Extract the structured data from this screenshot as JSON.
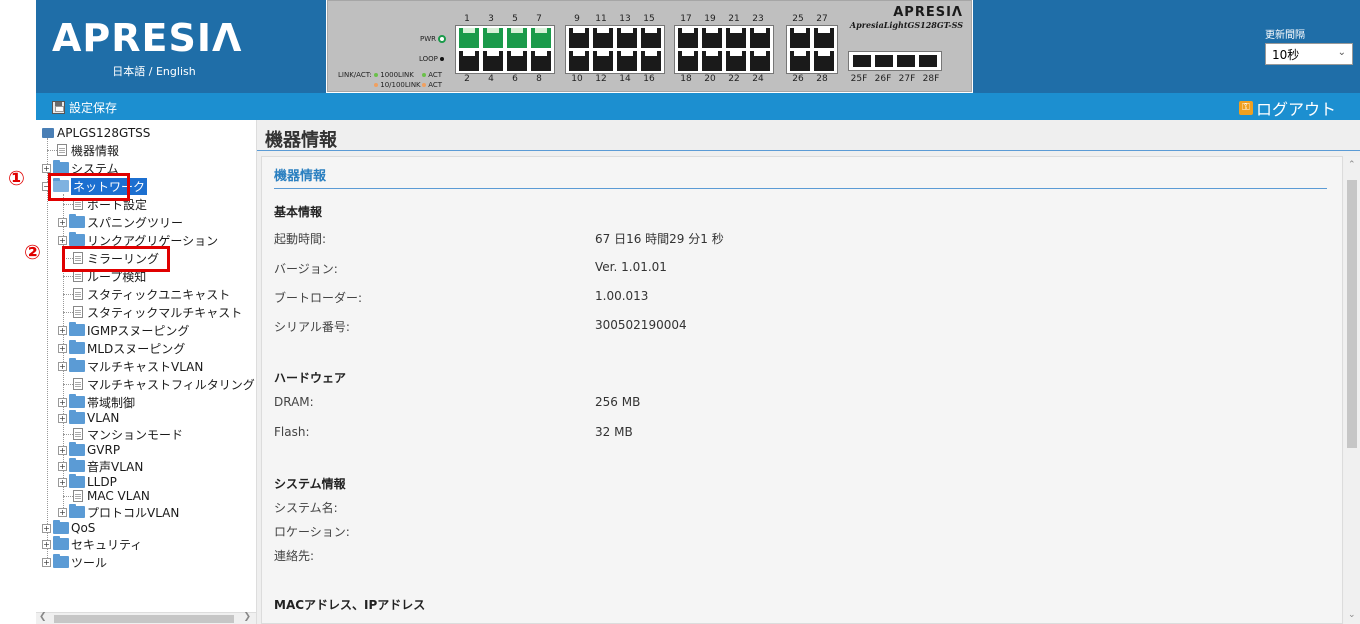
{
  "header": {
    "logo": "APRESIΛ",
    "lang_ja": "日本語",
    "lang_sep": " / ",
    "lang_en": "English",
    "device": {
      "brand": "APRESIΛ",
      "model": "ApresiaLightGS128GT-SS",
      "pwr": "PWR",
      "loop": "LOOP",
      "linkact": "LINK/ACT:",
      "link1000": "1000LINK",
      "link10100": "10/100LINK",
      "act1": "ACT",
      "act2": "ACT",
      "top_ports": [
        "1",
        "3",
        "5",
        "7",
        "9",
        "11",
        "13",
        "15",
        "17",
        "19",
        "21",
        "23",
        "25",
        "27"
      ],
      "bottom_ports": [
        "2",
        "4",
        "6",
        "8",
        "10",
        "12",
        "14",
        "16",
        "18",
        "20",
        "22",
        "24",
        "26",
        "28"
      ],
      "sfp_ports": [
        "25F",
        "26F",
        "27F",
        "28F"
      ],
      "ports_up": 4
    },
    "refresh_label": "更新間隔",
    "refresh_value": "10秒"
  },
  "toolbar": {
    "save_label": "設定保存",
    "logout_label": "ログアウト"
  },
  "tree": {
    "root": "APLGS128GTSS",
    "items": [
      "機器情報",
      "システム",
      "ネットワーク",
      "ポート設定",
      "スパニングツリー",
      "リンクアグリゲーション",
      "ミラーリング",
      "ループ検知",
      "スタティックユニキャスト",
      "スタティックマルチキャスト",
      "IGMPスヌーピング",
      "MLDスヌーピング",
      "マルチキャストVLAN",
      "マルチキャストフィルタリング",
      "帯域制御",
      "VLAN",
      "マンションモード",
      "GVRP",
      "音声VLAN",
      "LLDP",
      "MAC VLAN",
      "プロトコルVLAN",
      "QoS",
      "セキュリティ",
      "ツール"
    ]
  },
  "annotations": {
    "one": "①",
    "two": "②"
  },
  "main": {
    "page_title": "機器情報",
    "panel_title": "機器情報",
    "basic": {
      "heading": "基本情報",
      "uptime_label": "起動時間:",
      "uptime_value": "67 日16 時間29 分1 秒",
      "version_label": "バージョン:",
      "version_value": "Ver. 1.01.01",
      "bootloader_label": "ブートローダー:",
      "bootloader_value": "1.00.013",
      "serial_label": "シリアル番号:",
      "serial_value": "300502190004"
    },
    "hardware": {
      "heading": "ハードウェア",
      "dram_label": "DRAM:",
      "dram_value": "256 MB",
      "flash_label": "Flash:",
      "flash_value": "32 MB"
    },
    "system": {
      "heading": "システム情報",
      "name_label": "システム名:",
      "location_label": "ロケーション:",
      "contact_label": "連絡先:"
    },
    "mac_ip_heading": "MACアドレス、IPアドレス"
  },
  "colors": {
    "header_blue": "#1f6ea8",
    "toolbar_blue": "#1c8fd0",
    "section_title_blue": "#2a7fc0",
    "annotation_red": "#e00000",
    "port_up_green": "#1a9a4a"
  }
}
